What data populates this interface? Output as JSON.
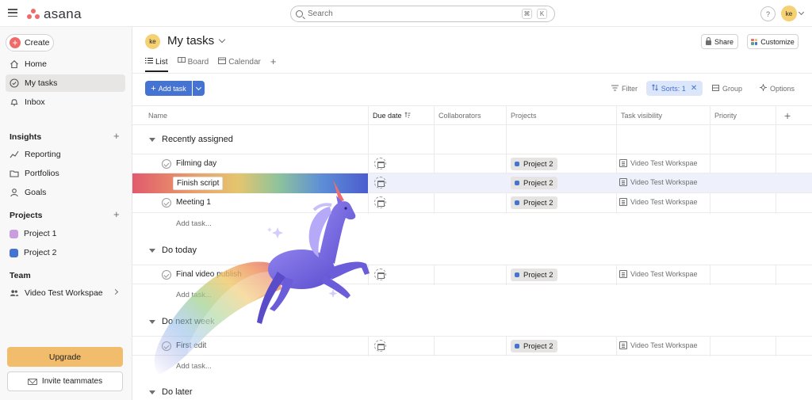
{
  "app": {
    "name": "asana"
  },
  "search": {
    "placeholder": "Search",
    "kbd1": "⌘",
    "kbd2": "K"
  },
  "user": {
    "initials": "ke",
    "help": "?"
  },
  "sidebar": {
    "create_label": "Create",
    "nav": [
      {
        "label": "Home",
        "icon": "home-icon"
      },
      {
        "label": "My tasks",
        "icon": "check-circle-icon",
        "active": true
      },
      {
        "label": "Inbox",
        "icon": "bell-icon"
      }
    ],
    "insights_label": "Insights",
    "insights": [
      {
        "label": "Reporting",
        "icon": "chart-line-icon"
      },
      {
        "label": "Portfolios",
        "icon": "folder-icon"
      },
      {
        "label": "Goals",
        "icon": "person-icon"
      }
    ],
    "projects_label": "Projects",
    "projects": [
      {
        "label": "Project 1",
        "color": "#c89ee0"
      },
      {
        "label": "Project 2",
        "color": "#4573d2"
      }
    ],
    "team_label": "Team",
    "team": {
      "label": "Video Test Workspae"
    },
    "upgrade_label": "Upgrade",
    "invite_label": "Invite teammates"
  },
  "header": {
    "title": "My tasks",
    "share_label": "Share",
    "customize_label": "Customize",
    "tabs": [
      {
        "label": "List",
        "active": true
      },
      {
        "label": "Board"
      },
      {
        "label": "Calendar"
      }
    ]
  },
  "toolbar": {
    "add_task_label": "Add task",
    "filter_label": "Filter",
    "sorts_label": "Sorts: 1",
    "group_label": "Group",
    "options_label": "Options"
  },
  "table": {
    "columns": [
      "Name",
      "Due date",
      "Collaborators",
      "Projects",
      "Task visibility",
      "Priority"
    ],
    "add_task_placeholder": "Add task...",
    "sections": [
      {
        "title": "Recently assigned",
        "tasks": [
          {
            "name": "Filming day",
            "project": "Project 2",
            "visibility": "Video Test Workspae"
          },
          {
            "name": "Finish script",
            "project": "Project 2",
            "visibility": "Video Test Workspae"
          },
          {
            "name": "Meeting 1",
            "project": "Project 2",
            "visibility": "Video Test Workspae"
          }
        ]
      },
      {
        "title": "Do today",
        "tasks": [
          {
            "name": "Final video publish",
            "project": "Project 2",
            "visibility": "Video Test Workspae"
          }
        ]
      },
      {
        "title": "Do next week",
        "tasks": [
          {
            "name": "First edit",
            "project": "Project 2",
            "visibility": "Video Test Workspae"
          }
        ]
      },
      {
        "title": "Do later",
        "tasks": []
      }
    ]
  },
  "colors": {
    "accent": "#4573d2",
    "brand": "#f06a6a",
    "upgrade": "#f1bd6c",
    "sorts_bg": "#dbe6fb"
  }
}
